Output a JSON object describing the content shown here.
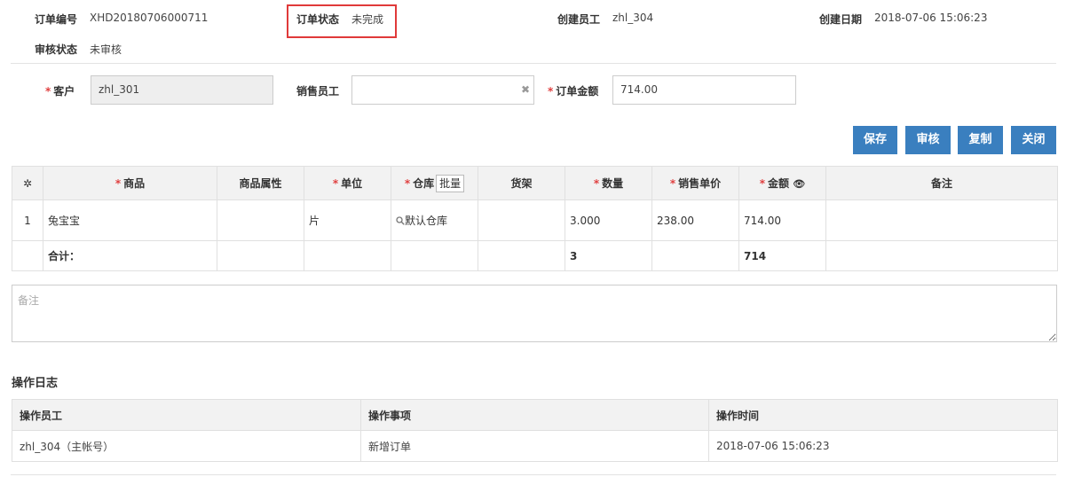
{
  "header": {
    "order_no_label": "订单编号",
    "order_no": "XHD20180706000711",
    "order_status_label": "订单状态",
    "order_status": "未完成",
    "creator_label": "创建员工",
    "creator": "zhl_304",
    "created_date_label": "创建日期",
    "created_date": "2018-07-06 15:06:23",
    "audit_status_label": "审核状态",
    "audit_status": "未审核"
  },
  "form": {
    "customer_label": "客户",
    "customer_value": "zhl_301",
    "sales_staff_label": "销售员工",
    "sales_staff_value": "",
    "clear_glyph": "✖",
    "order_amount_label": "订单金额",
    "order_amount_value": "714.00",
    "required_mark": "*"
  },
  "toolbar": {
    "save": "保存",
    "audit": "审核",
    "copy": "复制",
    "close": "关闭"
  },
  "items_table": {
    "headers": {
      "settings_glyph": "✲",
      "product": "商品",
      "attr": "商品属性",
      "unit": "单位",
      "warehouse": "仓库",
      "batch": "批量",
      "shelf": "货架",
      "qty": "数量",
      "price": "销售单价",
      "amount": "金额",
      "eye_glyph": "👁",
      "remark": "备注"
    },
    "rows": [
      {
        "index": "1",
        "product": "兔宝宝",
        "attr": "",
        "unit": "片",
        "warehouse_icon": "search-icon",
        "warehouse": "默认仓库",
        "shelf": "",
        "qty": "3.000",
        "price": "238.00",
        "amount": "714.00",
        "remark": ""
      }
    ],
    "total": {
      "label": "合计：",
      "qty": "3",
      "amount": "714"
    }
  },
  "remark": {
    "placeholder": "备注"
  },
  "log": {
    "title": "操作日志",
    "headers": [
      "操作员工",
      "操作事项",
      "操作时间"
    ],
    "rows": [
      [
        "zhl_304（主帐号）",
        "新增订单",
        "2018-07-06 15:06:23"
      ]
    ]
  },
  "colors": {
    "primary_button": "#3a7fbf",
    "highlight_border": "#e03a3a",
    "required": "#e04040"
  }
}
